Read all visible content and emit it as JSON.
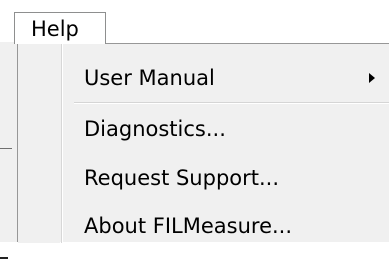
{
  "menubar": {
    "help_label": "Help"
  },
  "help_menu": {
    "items": [
      {
        "label": "User Manual",
        "has_submenu": true
      },
      {
        "label": "Diagnostics...",
        "has_submenu": false
      },
      {
        "label": "Request Support...",
        "has_submenu": false
      },
      {
        "label": "About FILMeasure...",
        "has_submenu": false
      }
    ]
  },
  "icons": {
    "submenu_arrow": "chevron-right-icon"
  }
}
